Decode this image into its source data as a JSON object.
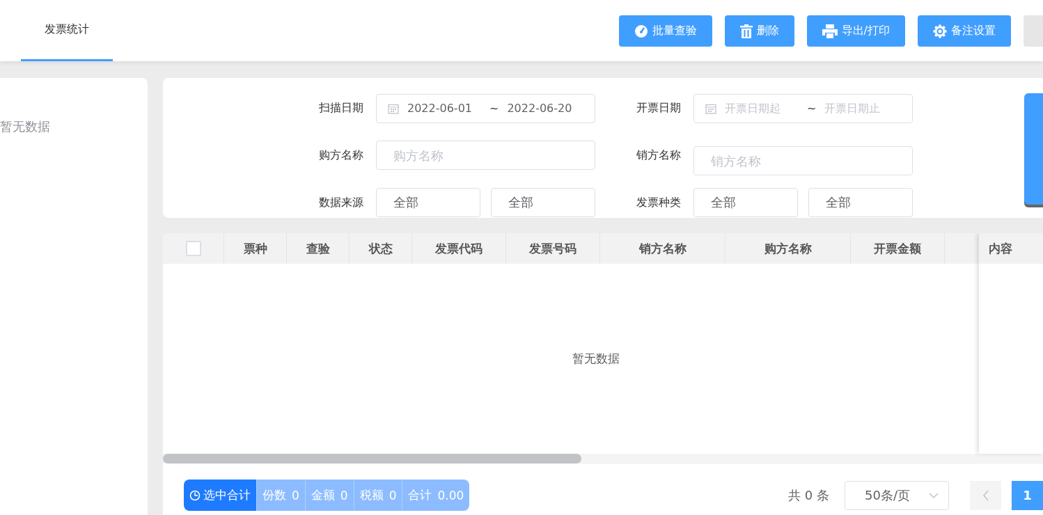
{
  "tabs": [
    {
      "label": "发票统计",
      "selected": true
    }
  ],
  "toolbar": [
    {
      "label": "批量查验"
    },
    {
      "label": "删除"
    },
    {
      "label": "导出/打印"
    },
    {
      "label": "备注设置"
    }
  ],
  "tree_panel": {
    "empty_text": "暂无数据"
  },
  "filters": [
    {
      "label": "扫描日期",
      "kind": "daterange",
      "start": {
        "value": "2022-06-01"
      },
      "separator": "~",
      "end": {
        "value": "2022-06-20"
      }
    },
    {
      "label": "开票日期",
      "kind": "daterange",
      "start": {
        "placeholder": "开票日期起"
      },
      "separator": "~",
      "end": {
        "placeholder": "开票日期止"
      }
    },
    {
      "label": "购方名称",
      "kind": "text",
      "placeholder": "购方名称"
    },
    {
      "label": "销方名称",
      "kind": "text",
      "placeholder": "销方名称"
    },
    {
      "label": "数据来源",
      "kind": "selectpair",
      "values": [
        "全部",
        "全部"
      ]
    },
    {
      "label": "发票种类",
      "kind": "selectpair",
      "values": [
        "全部",
        "全部"
      ]
    }
  ],
  "table": {
    "select_all": {
      "checked": false
    },
    "columns": [
      "票种",
      "查验",
      "状态",
      "发票代码",
      "发票号码",
      "销方名称",
      "购方名称",
      "开票金额"
    ],
    "fixed_column": "内容",
    "empty_text": "暂无数据"
  },
  "footer": {
    "summary": {
      "label": "选中合计",
      "items": [
        {
          "label": "份数",
          "value": "0"
        },
        {
          "label": "金额",
          "value": "0"
        },
        {
          "label": "税额",
          "value": "0"
        },
        {
          "label": "合计",
          "value": "0.00"
        }
      ]
    },
    "total": "共 0 条",
    "page_size": "50条/页",
    "prev": {
      "disabled": true
    },
    "pages": [
      {
        "label": "1",
        "selected": true
      }
    ]
  }
}
